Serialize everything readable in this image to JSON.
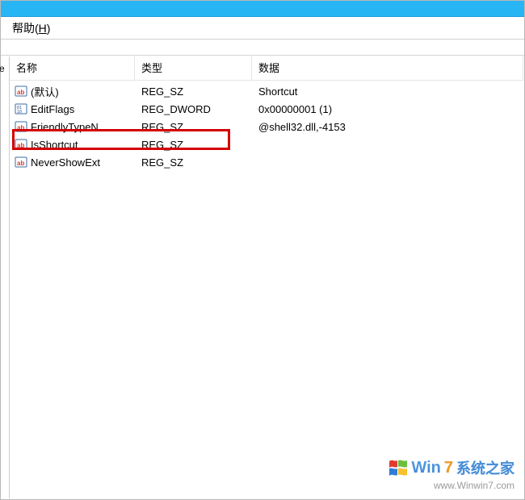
{
  "menu": {
    "help_label": "帮助",
    "help_accel": "H"
  },
  "tree_fragment": "e",
  "columns": {
    "name": "名称",
    "type": "类型",
    "data": "数据"
  },
  "rows": [
    {
      "icon": "string",
      "name": "(默认)",
      "type": "REG_SZ",
      "data": "Shortcut"
    },
    {
      "icon": "binary",
      "name": "EditFlags",
      "type": "REG_DWORD",
      "data": "0x00000001 (1)"
    },
    {
      "icon": "string",
      "name": "FriendlyTypeN...",
      "type": "REG_SZ",
      "data": "@shell32.dll,-4153"
    },
    {
      "icon": "string",
      "name": "IsShortcut",
      "type": "REG_SZ",
      "data": ""
    },
    {
      "icon": "string",
      "name": "NeverShowExt",
      "type": "REG_SZ",
      "data": ""
    }
  ],
  "highlighted_row_index": 3,
  "watermark": {
    "brand_prefix": "Win",
    "brand_num": "7",
    "brand_suffix_cn": "系统之家",
    "url": "www.Winwin7.com"
  }
}
